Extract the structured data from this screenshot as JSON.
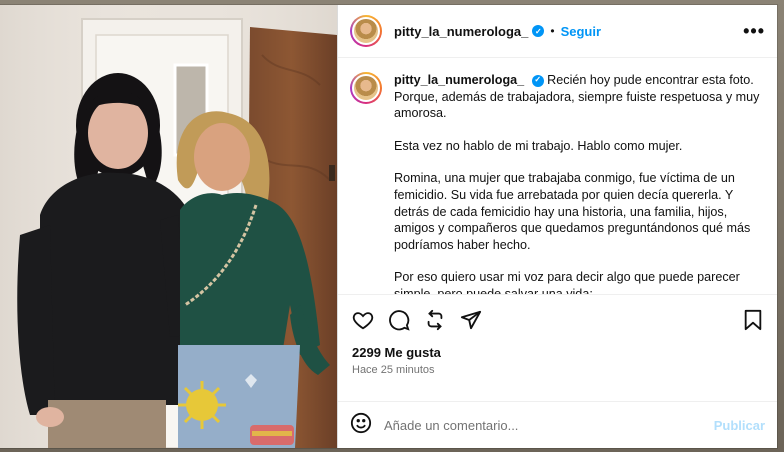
{
  "post": {
    "username": "pitty_la_numerologa_",
    "verified_mark": "✓",
    "separator": "•",
    "follow_label": "Seguir",
    "more_label": "•••",
    "caption_intro": "Recién hoy pude encontrar esta foto. Porque, además de trabajadora, siempre fuiste respetuosa y muy amorosa.",
    "caption_paragraphs": [
      "Esta vez no hablo de mi trabajo. Hablo como mujer.",
      "Romina, una mujer que trabajaba conmigo, fue víctima de un femicidio. Su vida fue arrebatada por quien decía quererla. Y detrás de cada femicidio hay una historia, una familia, hijos, amigos y compañeros que quedamos preguntándonos qué más podríamos haber hecho.",
      "Por eso quiero usar mi voz para decir algo que puede parecer simple, pero puede salvar una vida:"
    ],
    "likes": "2299 Me gusta",
    "time": "Hace 25 minutos"
  },
  "comment": {
    "placeholder": "Añade un comentario...",
    "publish_label": "Publicar"
  },
  "icons": {
    "like": "heart-icon",
    "comment": "comment-icon",
    "share": "share-icon",
    "send": "send-icon",
    "save": "bookmark-icon",
    "emoji": "emoji-icon"
  },
  "colors": {
    "accent": "#0095f6",
    "publish_disabled": "#b2dffc",
    "muted": "#737373"
  }
}
